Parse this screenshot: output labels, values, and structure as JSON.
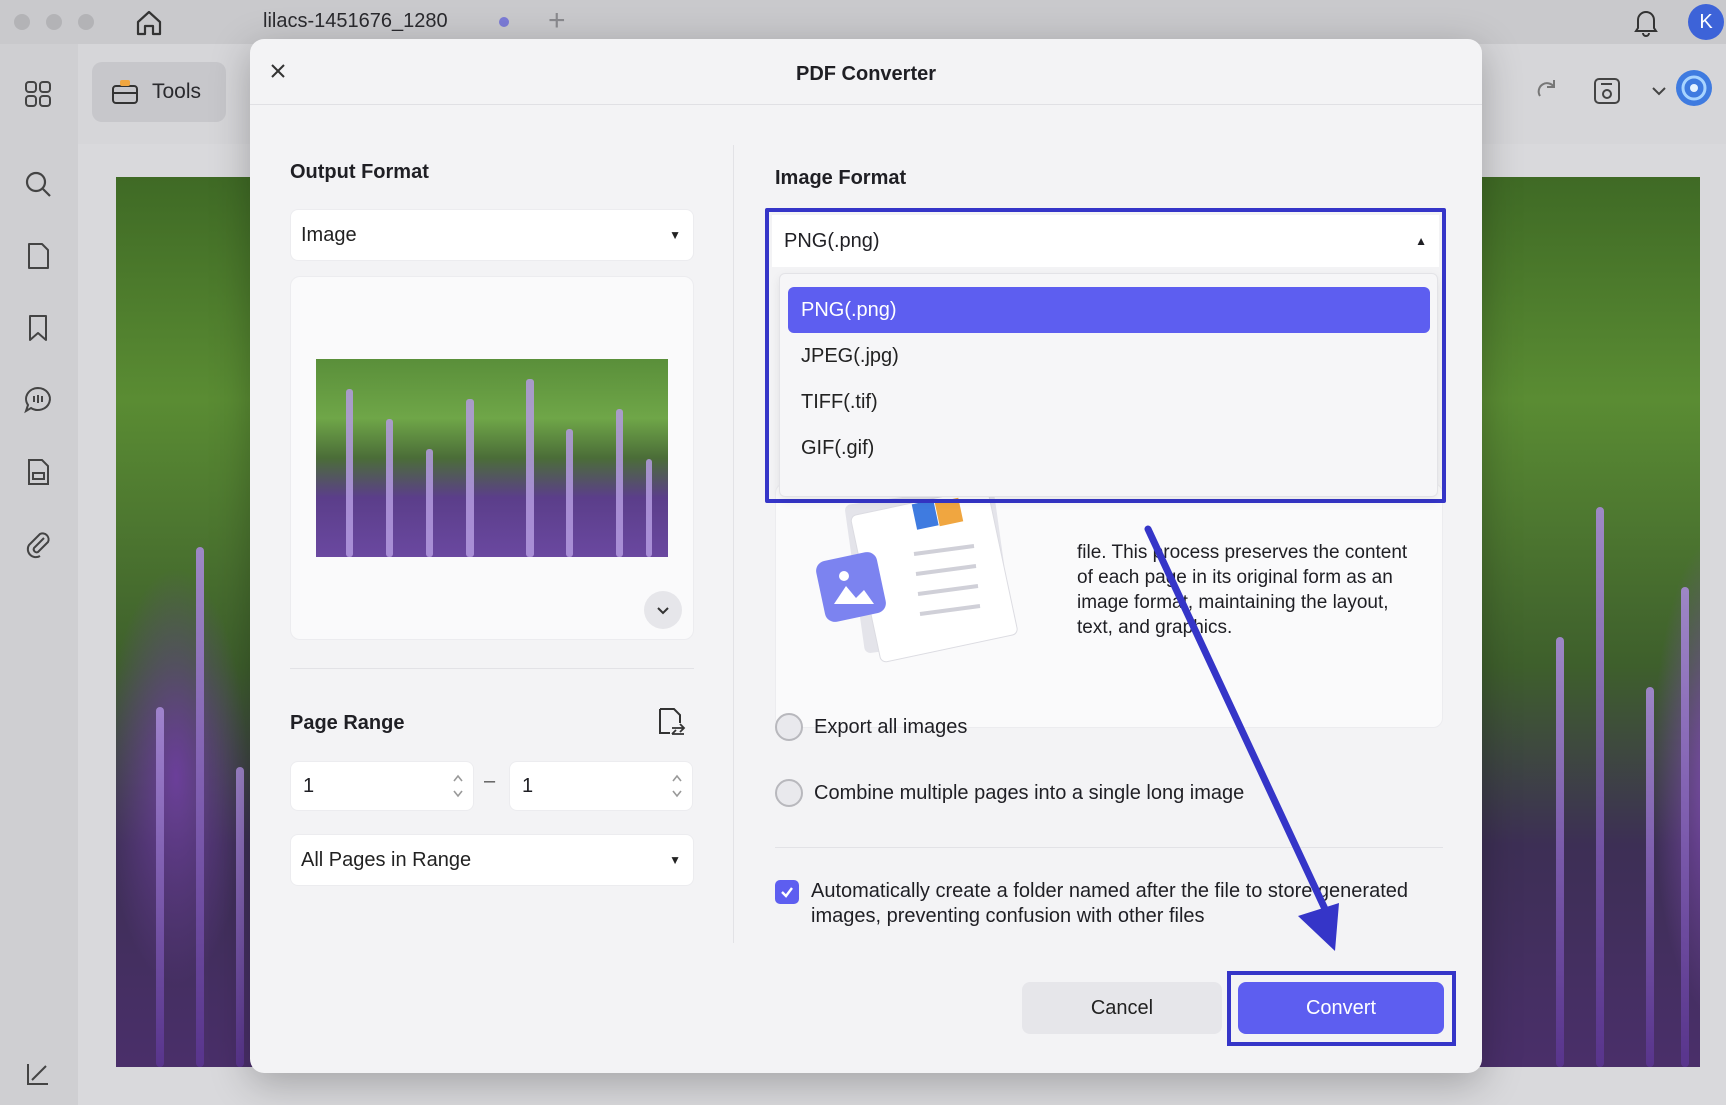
{
  "window": {
    "tab_title": "lilacs-1451676_1280",
    "avatar_initial": "K"
  },
  "toolbar": {
    "tools_label": "Tools"
  },
  "dialog": {
    "title": "PDF Converter",
    "output_format": {
      "label": "Output Format",
      "value": "Image"
    },
    "page_range": {
      "label": "Page Range",
      "from": "1",
      "to": "1",
      "dash": "–",
      "subset": "All Pages in Range"
    },
    "image_format": {
      "label": "Image Format",
      "value": "PNG(.png)",
      "options": [
        "PNG(.png)",
        "JPEG(.jpg)",
        "TIFF(.tif)",
        "GIF(.gif)"
      ],
      "selected_index": 0
    },
    "description": "file. This process preserves the content of each page in its original form as an image format, maintaining the layout, text, and graphics.",
    "options": {
      "export_all_images": "Export all images",
      "combine_pages": "Combine multiple pages into a single long image",
      "auto_folder": "Automatically create a folder named after the file to store generated images, preventing confusion with other files",
      "auto_folder_checked": true
    },
    "buttons": {
      "cancel": "Cancel",
      "convert": "Convert"
    }
  },
  "colors": {
    "accent": "#5d5ef0",
    "highlight_frame": "#3535c8"
  }
}
